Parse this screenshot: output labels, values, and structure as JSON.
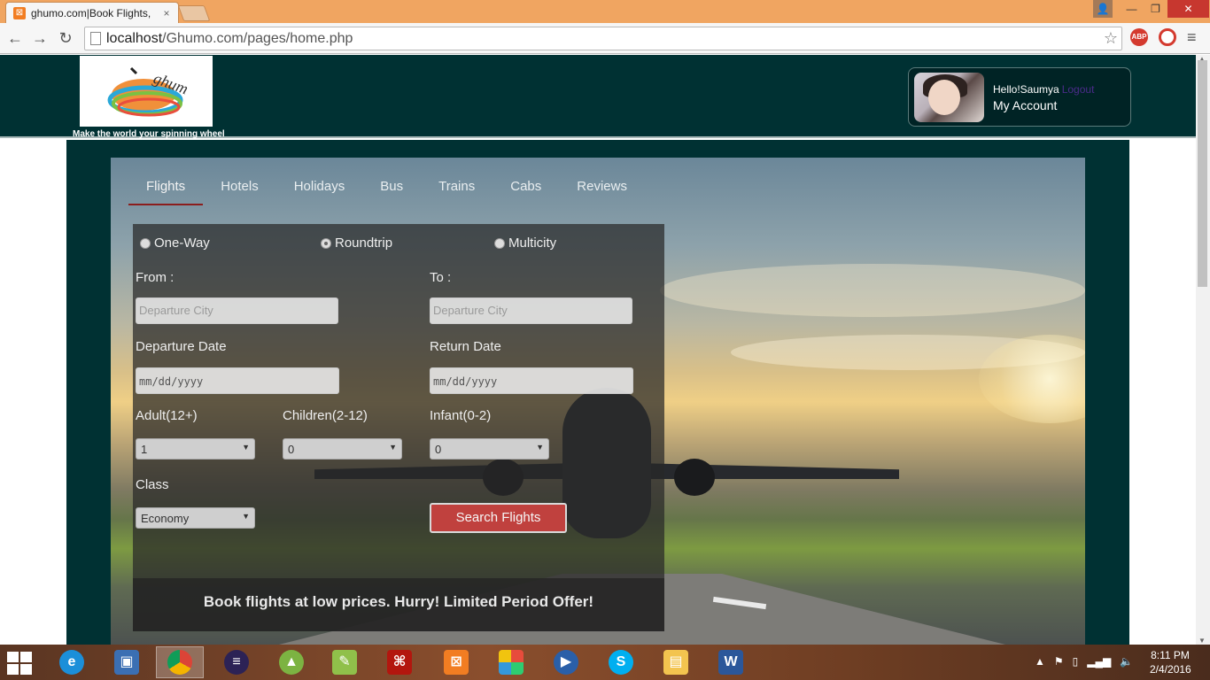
{
  "browser": {
    "tab_title": "ghumo.com|Book Flights,",
    "tab_close": "×",
    "url_host": "localhost",
    "url_path": "/Ghumo.com/pages/home.php",
    "ext_abp": "ABP"
  },
  "header": {
    "tagline": "Make the world your spinning wheel",
    "hello": "Hello!Saumya",
    "logout": "Logout",
    "my_account": "My Account"
  },
  "nav": {
    "tabs": [
      "Flights",
      "Hotels",
      "Holidays",
      "Bus",
      "Trains",
      "Cabs",
      "Reviews"
    ],
    "active": "Flights"
  },
  "form": {
    "trip_types": [
      "One-Way",
      "Roundtrip",
      "Multicity"
    ],
    "selected_trip": "Roundtrip",
    "from_label": "From :",
    "to_label": "To :",
    "from_placeholder": "Departure City",
    "to_placeholder": "Departure City",
    "departure_label": "Departure Date",
    "return_label": "Return Date",
    "date_placeholder": "mm/dd/yyyy",
    "adult_label": "Adult(12+)",
    "children_label": "Children(2-12)",
    "infant_label": "Infant(0-2)",
    "adult_value": "1",
    "children_value": "0",
    "infant_value": "0",
    "class_label": "Class",
    "class_value": "Economy",
    "search_button": "Search Flights",
    "offer": "Book flights at low prices. Hurry! Limited Period Offer!"
  },
  "taskbar": {
    "time": "8:11 PM",
    "date": "2/4/2016"
  }
}
